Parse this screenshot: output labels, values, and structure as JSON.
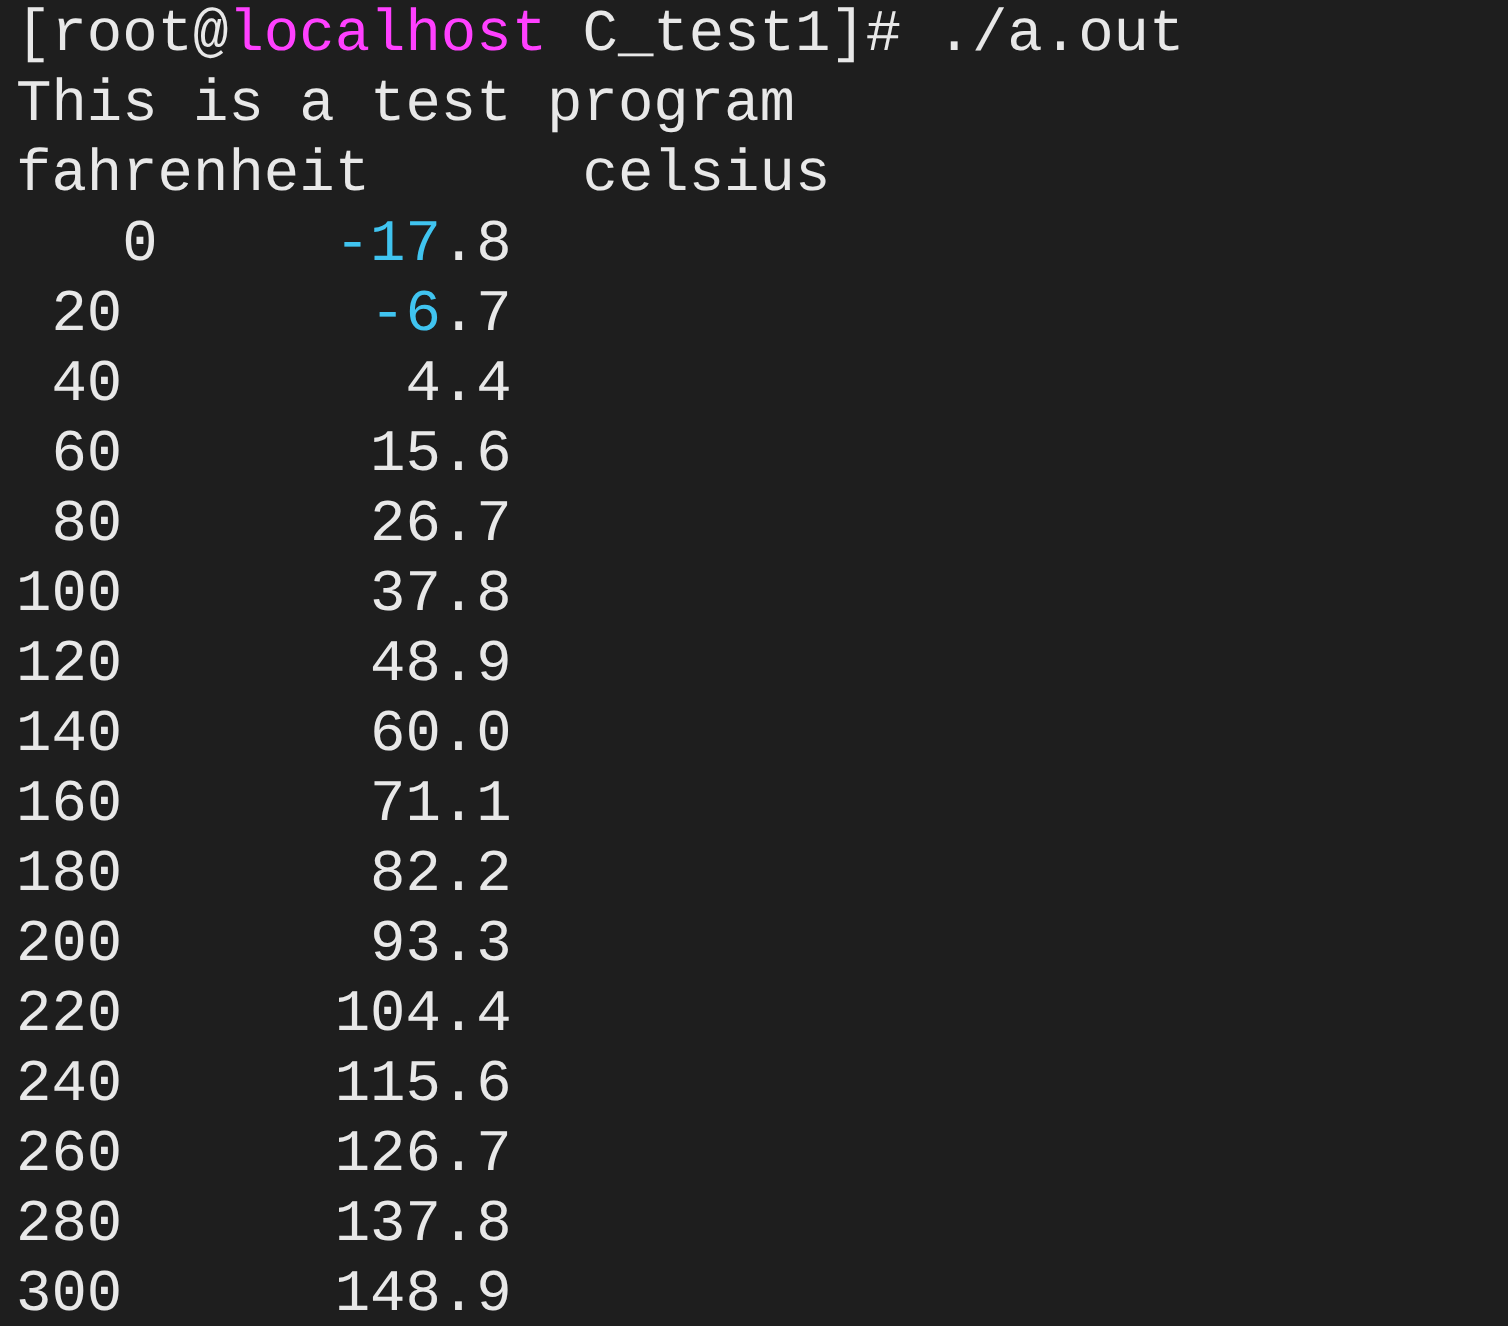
{
  "lines": [
    {
      "segments": [
        {
          "text": "[root@",
          "color": "#e8e8e8"
        },
        {
          "text": "localhost",
          "color": "#ff40ff"
        },
        {
          "text": " C_test1]# ./a.out",
          "color": "#e8e8e8"
        }
      ]
    },
    {
      "segments": [
        {
          "text": "This is a test program",
          "color": "#e8e8e8"
        }
      ]
    },
    {
      "segments": [
        {
          "text": "fahrenheit      celsius",
          "color": "#e8e8e8"
        }
      ]
    },
    {
      "segments": [
        {
          "text": "   0     ",
          "color": "#e8e8e8"
        },
        {
          "text": "-17",
          "color": "#40c4f0"
        },
        {
          "text": ".8",
          "color": "#e8e8e8"
        }
      ]
    },
    {
      "segments": [
        {
          "text": " 20       ",
          "color": "#e8e8e8"
        },
        {
          "text": "-6",
          "color": "#40c4f0"
        },
        {
          "text": ".7",
          "color": "#e8e8e8"
        }
      ]
    },
    {
      "segments": [
        {
          "text": " 40        4.4",
          "color": "#e8e8e8"
        }
      ]
    },
    {
      "segments": [
        {
          "text": " 60       15.6",
          "color": "#e8e8e8"
        }
      ]
    },
    {
      "segments": [
        {
          "text": " 80       26.7",
          "color": "#e8e8e8"
        }
      ]
    },
    {
      "segments": [
        {
          "text": "100       37.8",
          "color": "#e8e8e8"
        }
      ]
    },
    {
      "segments": [
        {
          "text": "120       48.9",
          "color": "#e8e8e8"
        }
      ]
    },
    {
      "segments": [
        {
          "text": "140       60.0",
          "color": "#e8e8e8"
        }
      ]
    },
    {
      "segments": [
        {
          "text": "160       71.1",
          "color": "#e8e8e8"
        }
      ]
    },
    {
      "segments": [
        {
          "text": "180       82.2",
          "color": "#e8e8e8"
        }
      ]
    },
    {
      "segments": [
        {
          "text": "200       93.3",
          "color": "#e8e8e8"
        }
      ]
    },
    {
      "segments": [
        {
          "text": "220      104.4",
          "color": "#e8e8e8"
        }
      ]
    },
    {
      "segments": [
        {
          "text": "240      115.6",
          "color": "#e8e8e8"
        }
      ]
    },
    {
      "segments": [
        {
          "text": "260      126.7",
          "color": "#e8e8e8"
        }
      ]
    },
    {
      "segments": [
        {
          "text": "280      137.8",
          "color": "#e8e8e8"
        }
      ]
    },
    {
      "segments": [
        {
          "text": "300      148.9",
          "color": "#e8e8e8"
        }
      ]
    }
  ]
}
